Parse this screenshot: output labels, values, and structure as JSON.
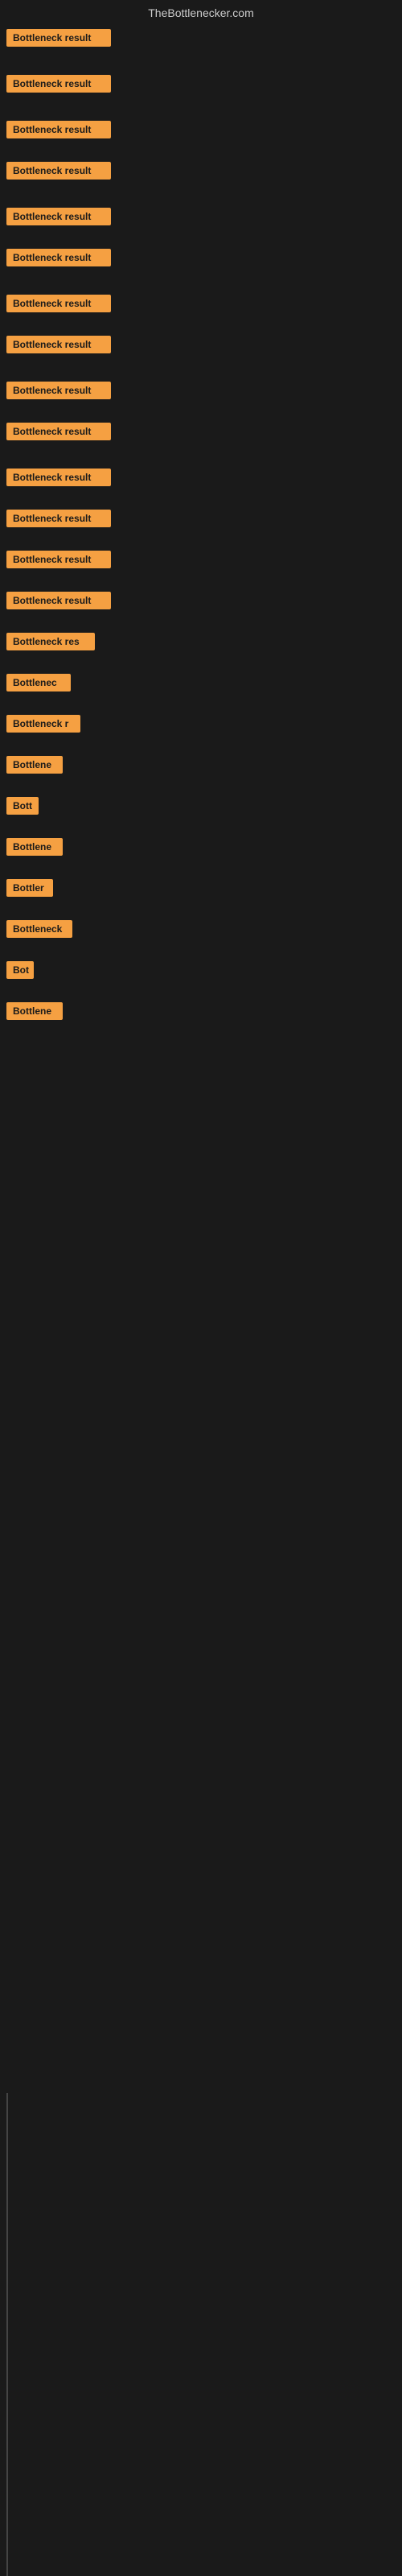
{
  "header": {
    "title": "TheBottlenecker.com"
  },
  "accent_color": "#f5a042",
  "results": [
    {
      "id": 1,
      "label": "Bottleneck result",
      "width": 130
    },
    {
      "id": 2,
      "label": "Bottleneck result",
      "width": 130
    },
    {
      "id": 3,
      "label": "Bottleneck result",
      "width": 130
    },
    {
      "id": 4,
      "label": "Bottleneck result",
      "width": 130
    },
    {
      "id": 5,
      "label": "Bottleneck result",
      "width": 130
    },
    {
      "id": 6,
      "label": "Bottleneck result",
      "width": 130
    },
    {
      "id": 7,
      "label": "Bottleneck result",
      "width": 130
    },
    {
      "id": 8,
      "label": "Bottleneck result",
      "width": 130
    },
    {
      "id": 9,
      "label": "Bottleneck result",
      "width": 130
    },
    {
      "id": 10,
      "label": "Bottleneck result",
      "width": 130
    },
    {
      "id": 11,
      "label": "Bottleneck result",
      "width": 130
    },
    {
      "id": 12,
      "label": "Bottleneck result",
      "width": 130
    },
    {
      "id": 13,
      "label": "Bottleneck result",
      "width": 130
    },
    {
      "id": 14,
      "label": "Bottleneck result",
      "width": 130
    },
    {
      "id": 15,
      "label": "Bottleneck res",
      "width": 110
    },
    {
      "id": 16,
      "label": "Bottlenec",
      "width": 80
    },
    {
      "id": 17,
      "label": "Bottleneck r",
      "width": 90
    },
    {
      "id": 18,
      "label": "Bottlene",
      "width": 72
    },
    {
      "id": 19,
      "label": "Bott",
      "width": 44
    },
    {
      "id": 20,
      "label": "Bottlene",
      "width": 72
    },
    {
      "id": 21,
      "label": "Bottler",
      "width": 60
    },
    {
      "id": 22,
      "label": "Bottleneck",
      "width": 84
    },
    {
      "id": 23,
      "label": "Bot",
      "width": 36
    },
    {
      "id": 24,
      "label": "Bottlene",
      "width": 72
    }
  ]
}
